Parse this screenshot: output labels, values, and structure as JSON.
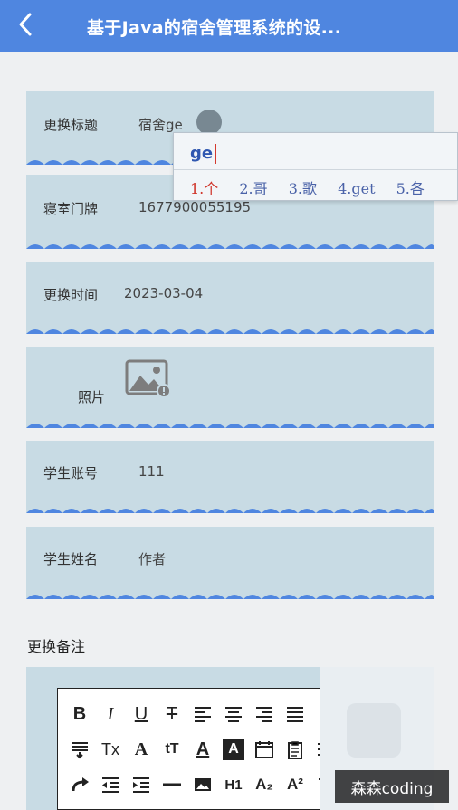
{
  "header": {
    "title": "基于Java的宿舍管理系统的设..."
  },
  "fields": [
    {
      "label": "更换标题",
      "value": "宿舍ge"
    },
    {
      "label": "寝室门牌",
      "value": "1677900055195"
    },
    {
      "label": "更换时间",
      "value": "2023-03-04"
    },
    {
      "label": "照片",
      "value": ""
    },
    {
      "label": "学生账号",
      "value": "111"
    },
    {
      "label": "学生姓名",
      "value": "作者"
    }
  ],
  "ime": {
    "typed": "ge",
    "candidates": [
      "1.个",
      "2.哥",
      "3.歌",
      "4.get",
      "5.各"
    ]
  },
  "remarks": {
    "label": "更换备注"
  },
  "watermark": "森森coding",
  "colors": {
    "header": "#4f86e0",
    "card": "#c8dbe4",
    "wave": "#4f86e0"
  }
}
